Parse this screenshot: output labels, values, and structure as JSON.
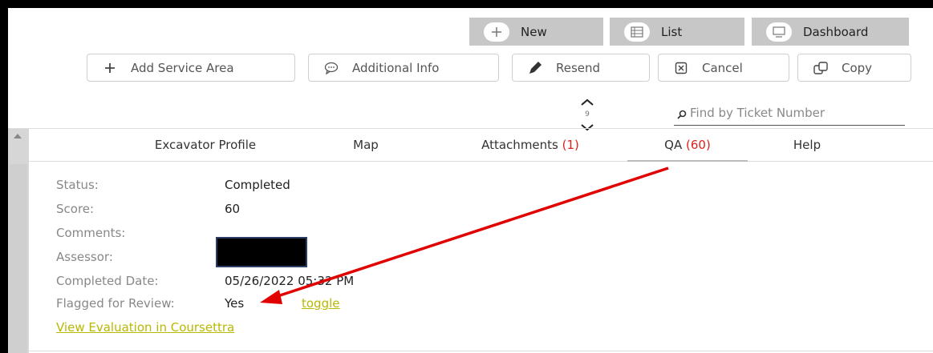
{
  "top_nav": {
    "new_label": "New",
    "list_label": "List",
    "dashboard_label": "Dashboard"
  },
  "actions": {
    "add_service_area": "Add Service Area",
    "additional_info": "Additional Info",
    "resend": "Resend",
    "cancel": "Cancel",
    "copy": "Copy"
  },
  "stepper": {
    "value": "9"
  },
  "search": {
    "placeholder": "Find by Ticket Number"
  },
  "tabs": [
    {
      "label": "Excavator Profile",
      "count": ""
    },
    {
      "label": "Map",
      "count": ""
    },
    {
      "label": "Attachments ",
      "count": "(1)"
    },
    {
      "label": "QA ",
      "count": "(60)"
    },
    {
      "label": "Help",
      "count": ""
    }
  ],
  "active_tab": "QA",
  "qa": {
    "status_label": "Status:",
    "status_value": "Completed",
    "score_label": "Score:",
    "score_value": "60",
    "comments_label": "Comments:",
    "comments_value": "",
    "assessor_label": "Assessor:",
    "completed_date_label": "Completed Date:",
    "completed_date_value": "05/26/2022 05:32 PM",
    "flagged_label": "Flagged for Review:",
    "flagged_value": "Yes",
    "toggle_link": "toggle",
    "eval_link": "View Evaluation in Coursettra"
  },
  "colors": {
    "accent_link": "#b8b800",
    "count_red": "#e02020",
    "annotation_arrow": "#e00000"
  }
}
